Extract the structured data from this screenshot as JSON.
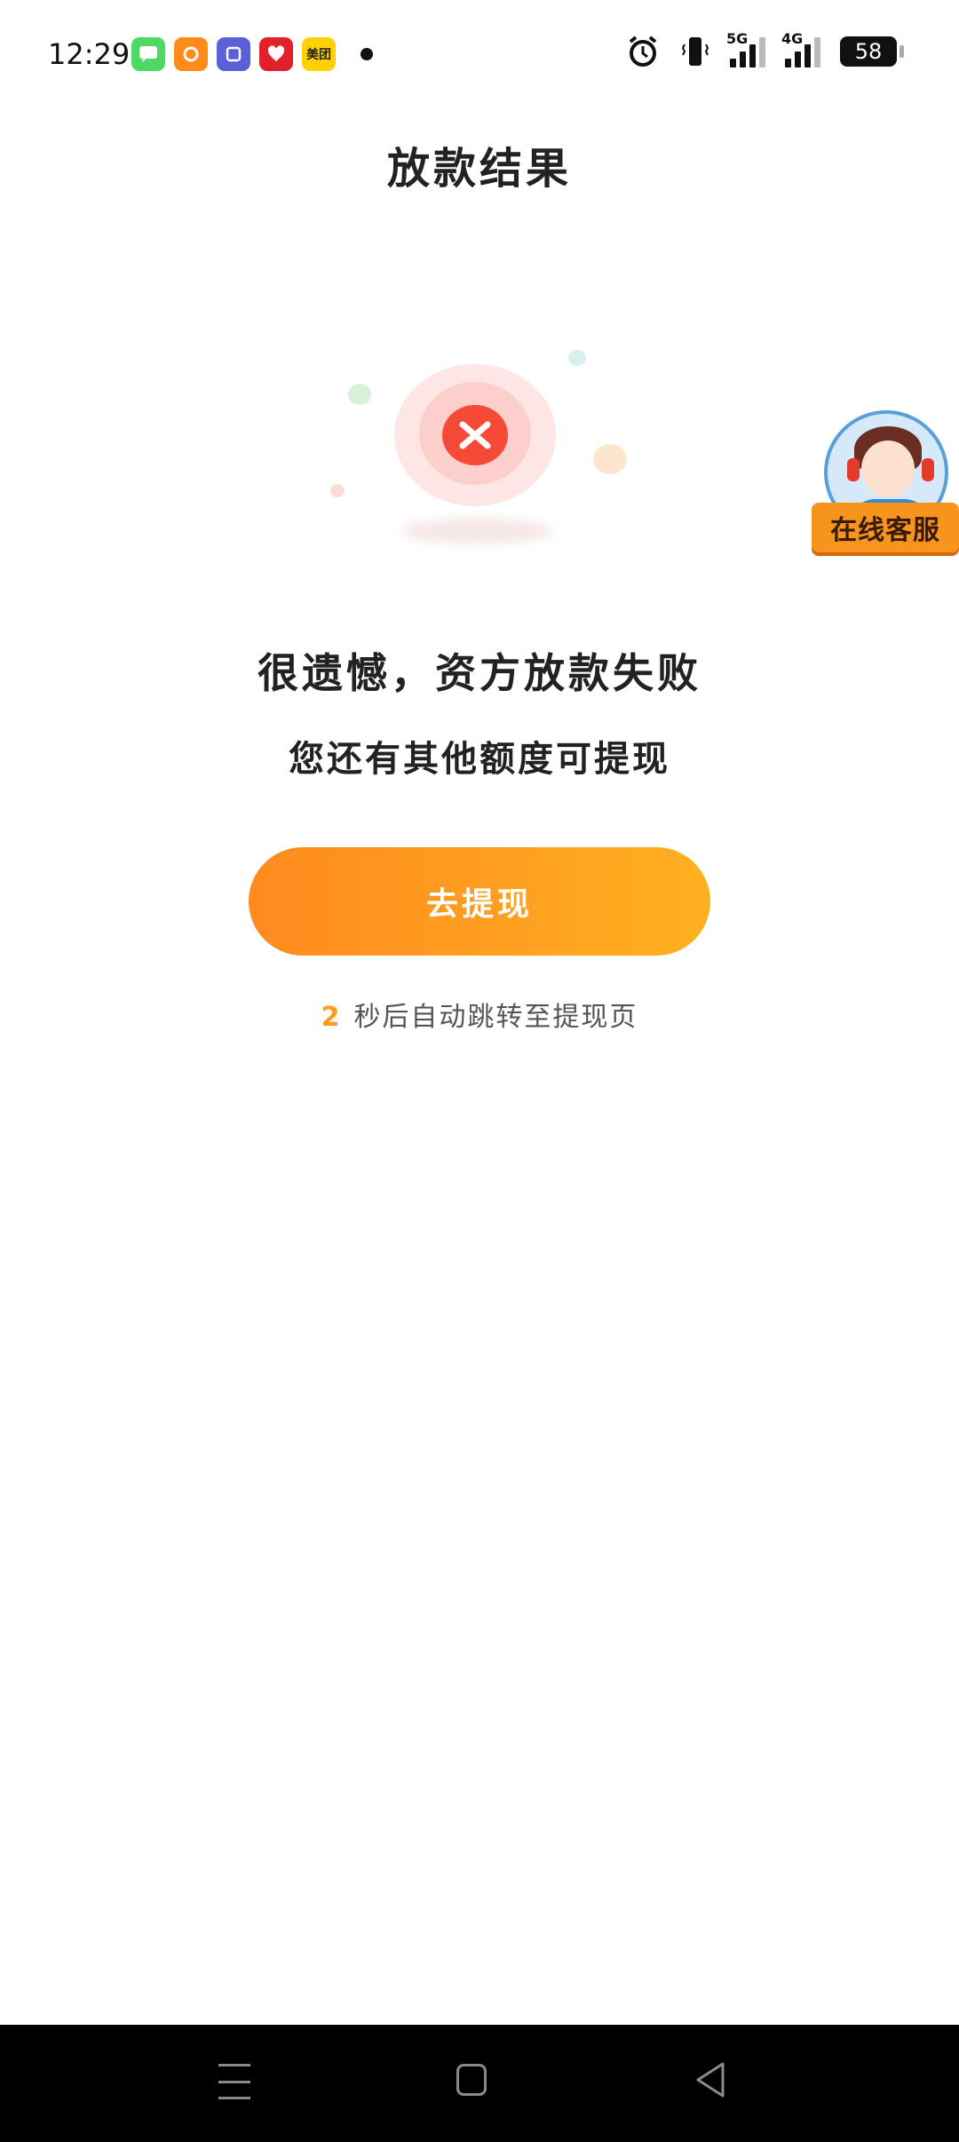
{
  "status_bar": {
    "time": "12:29",
    "notifications": [
      {
        "icon": "messages-icon",
        "color": "#4cd964"
      },
      {
        "icon": "orange-app-icon",
        "color": "#ff8c1a"
      },
      {
        "icon": "tieba-icon",
        "color": "#5b5fd8"
      },
      {
        "icon": "pinduoduo-icon",
        "color": "#e0212b"
      },
      {
        "icon": "meituan-icon",
        "color": "#ffd100",
        "label": "美团"
      }
    ],
    "network_1": "5G",
    "network_2": "4G",
    "battery": "58"
  },
  "header": {
    "title": "放款结果"
  },
  "result": {
    "status_icon": "close-icon",
    "accent_color": "#f44a36",
    "main_message": "很遗憾，资方放款失败",
    "sub_message": "您还有其他额度可提现"
  },
  "action": {
    "button_label": "去提现",
    "countdown_value": "2",
    "countdown_text": "秒后自动跳转至提现页",
    "button_colors": [
      "#ff8a1f",
      "#ffb020"
    ]
  },
  "customer_service": {
    "label": "在线客服",
    "icon": "customer-service-avatar-icon"
  },
  "nav_bar": {
    "menu_icon": "menu-icon",
    "home_icon": "home-icon",
    "back_icon": "back-icon"
  }
}
